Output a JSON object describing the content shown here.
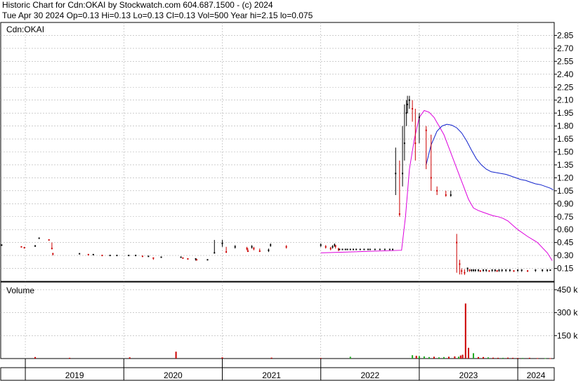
{
  "header": {
    "line1": "Historic Chart for Cdn:OKAI by Stockwatch.com 604.687.1500 - (c) 2024",
    "line2": "Tue Apr 30 2024  Op=0.13  Hi=0.13  Lo=0.13  Cl=0.13  Vol=500  Year hi=2.15  lo=0.075"
  },
  "colors": {
    "price_up": "#000000",
    "price_down": "#cc0000",
    "ma_short": "#dd00dd",
    "ma_long": "#1122cc",
    "grid": "#b0b0b0",
    "volume_up": "#cc0000",
    "volume_down": "#22aa22"
  },
  "chart_data": [
    {
      "type": "line",
      "title": "Cdn:OKAI",
      "grid": true,
      "ylim": [
        0,
        3.0
      ],
      "y_ticks": [
        "2.85",
        "2.70",
        "2.55",
        "2.40",
        "2.25",
        "2.10",
        "1.95",
        "1.80",
        "1.65",
        "1.50",
        "1.35",
        "1.20",
        "1.05",
        "0.90",
        "0.75",
        "0.60",
        "0.45",
        "0.30",
        "0.15"
      ],
      "x_ticks": [
        "2019",
        "2020",
        "2021",
        "2022",
        "2023",
        "2024"
      ],
      "x_range": [
        2018.75,
        2024.37
      ],
      "series": [
        {
          "kind": "price",
          "x": [
            2018.76,
            2018.96,
            2018.99,
            2019.1,
            2019.14,
            2019.24,
            2019.27,
            2019.28,
            2019.55,
            2019.64,
            2019.69,
            2019.78,
            2019.86,
            2019.93,
            2020.05,
            2020.12,
            2020.19,
            2020.25,
            2020.3,
            2020.38,
            2020.58,
            2020.6,
            2020.65,
            2020.73,
            2020.74,
            2020.85,
            2020.92,
            2021.0,
            2021.04,
            2021.13,
            2021.25,
            2021.26,
            2021.3,
            2021.32,
            2021.38,
            2021.47,
            2021.49,
            2021.65,
            2022.0,
            2022.05,
            2022.1,
            2022.12,
            2022.14,
            2022.15,
            2022.18,
            2022.19,
            2022.22,
            2022.25,
            2022.27,
            2022.3,
            2022.33,
            2022.36,
            2022.4,
            2022.44,
            2022.48,
            2022.5,
            2022.55,
            2022.6,
            2022.65,
            2022.7,
            2022.73,
            2022.76,
            2022.8,
            2022.83,
            2022.85,
            2022.87,
            2022.88,
            2022.9,
            2022.93,
            2022.96,
            2023.0,
            2023.07,
            2023.12,
            2023.18,
            2023.27,
            2023.32,
            2023.38,
            2023.41,
            2023.43,
            2023.46,
            2023.49,
            2023.51,
            2023.53,
            2023.55,
            2023.57,
            2023.6,
            2023.62,
            2023.65,
            2023.68,
            2023.71,
            2023.74,
            2023.77,
            2023.79,
            2023.81,
            2023.84,
            2023.88,
            2023.92,
            2023.96,
            2024.0,
            2024.04,
            2024.1,
            2024.18,
            2024.25,
            2024.3,
            2024.33
          ],
          "close": [
            0.42,
            0.4,
            0.39,
            0.41,
            0.5,
            0.48,
            0.38,
            0.32,
            0.32,
            0.31,
            0.31,
            0.3,
            0.3,
            0.3,
            0.3,
            0.3,
            0.29,
            0.29,
            0.27,
            0.28,
            0.28,
            0.27,
            0.26,
            0.26,
            0.25,
            0.25,
            0.33,
            0.44,
            0.34,
            0.4,
            0.38,
            0.35,
            0.4,
            0.38,
            0.35,
            0.36,
            0.42,
            0.4,
            0.42,
            0.4,
            0.38,
            0.4,
            0.42,
            0.41,
            0.37,
            0.37,
            0.37,
            0.37,
            0.37,
            0.37,
            0.37,
            0.37,
            0.37,
            0.37,
            0.37,
            0.37,
            0.37,
            0.37,
            0.37,
            0.37,
            0.37,
            1.25,
            0.78,
            1.25,
            1.6,
            1.95,
            2.05,
            2.1,
            2.0,
            1.6,
            1.9,
            1.75,
            1.2,
            1.05,
            1.0,
            1.0,
            0.45,
            0.2,
            0.12,
            0.1,
            0.15,
            0.13,
            0.13,
            0.13,
            0.13,
            0.13,
            0.12,
            0.13,
            0.13,
            0.12,
            0.13,
            0.13,
            0.12,
            0.13,
            0.13,
            0.13,
            0.13,
            0.12,
            0.13,
            0.13,
            0.12,
            0.13,
            0.13,
            0.13,
            0.13
          ],
          "high": [
            0.42,
            0.4,
            0.4,
            0.42,
            0.5,
            0.48,
            0.45,
            0.33,
            0.32,
            0.31,
            0.31,
            0.3,
            0.3,
            0.3,
            0.3,
            0.3,
            0.29,
            0.29,
            0.27,
            0.28,
            0.28,
            0.27,
            0.26,
            0.26,
            0.25,
            0.25,
            0.48,
            0.48,
            0.4,
            0.42,
            0.4,
            0.38,
            0.42,
            0.4,
            0.38,
            0.38,
            0.44,
            0.42,
            0.44,
            0.42,
            0.4,
            0.42,
            0.44,
            0.42,
            0.39,
            0.37,
            0.37,
            0.37,
            0.37,
            0.37,
            0.37,
            0.37,
            0.37,
            0.37,
            0.37,
            0.37,
            0.37,
            0.37,
            0.37,
            0.37,
            0.37,
            1.55,
            1.4,
            1.8,
            2.05,
            2.1,
            2.15,
            2.15,
            2.1,
            2.0,
            1.95,
            1.8,
            1.7,
            1.1,
            1.05,
            1.05,
            0.55,
            0.25,
            0.15,
            0.14,
            0.16,
            0.14,
            0.14,
            0.14,
            0.14,
            0.14,
            0.13,
            0.14,
            0.14,
            0.13,
            0.14,
            0.14,
            0.13,
            0.14,
            0.14,
            0.14,
            0.14,
            0.13,
            0.14,
            0.14,
            0.13,
            0.14,
            0.14,
            0.14,
            0.13
          ],
          "low": [
            0.42,
            0.4,
            0.38,
            0.4,
            0.5,
            0.48,
            0.38,
            0.3,
            0.32,
            0.31,
            0.31,
            0.3,
            0.3,
            0.3,
            0.3,
            0.3,
            0.29,
            0.29,
            0.25,
            0.28,
            0.28,
            0.27,
            0.26,
            0.24,
            0.25,
            0.25,
            0.33,
            0.4,
            0.33,
            0.38,
            0.36,
            0.34,
            0.38,
            0.36,
            0.34,
            0.34,
            0.4,
            0.38,
            0.4,
            0.38,
            0.36,
            0.38,
            0.4,
            0.38,
            0.35,
            0.37,
            0.37,
            0.37,
            0.37,
            0.37,
            0.37,
            0.37,
            0.37,
            0.37,
            0.37,
            0.37,
            0.37,
            0.37,
            0.37,
            0.37,
            0.37,
            1.0,
            0.75,
            1.1,
            1.4,
            1.8,
            1.95,
            2.0,
            1.85,
            1.4,
            1.6,
            1.3,
            1.05,
            1.0,
            0.98,
            0.98,
            0.1,
            0.08,
            0.08,
            0.075,
            0.11,
            0.11,
            0.11,
            0.11,
            0.11,
            0.11,
            0.11,
            0.11,
            0.11,
            0.11,
            0.11,
            0.11,
            0.11,
            0.11,
            0.11,
            0.11,
            0.11,
            0.11,
            0.11,
            0.11,
            0.11,
            0.11,
            0.11,
            0.11,
            0.13
          ]
        },
        {
          "kind": "ma_short",
          "x": [
            2022.0,
            2022.82,
            2022.86,
            2022.9,
            2022.95,
            2023.0,
            2023.05,
            2023.1,
            2023.15,
            2023.2,
            2023.25,
            2023.3,
            2023.35,
            2023.4,
            2023.45,
            2023.5,
            2023.55,
            2023.6,
            2023.65,
            2023.7,
            2023.75,
            2023.8,
            2023.85,
            2023.9,
            2023.95,
            2024.0,
            2024.1,
            2024.2,
            2024.3,
            2024.35
          ],
          "values": [
            0.33,
            0.36,
            0.75,
            1.3,
            1.65,
            1.9,
            1.98,
            1.96,
            1.9,
            1.8,
            1.7,
            1.55,
            1.4,
            1.25,
            1.1,
            0.95,
            0.85,
            0.82,
            0.8,
            0.78,
            0.76,
            0.75,
            0.73,
            0.7,
            0.65,
            0.6,
            0.52,
            0.45,
            0.33,
            0.24
          ]
        },
        {
          "kind": "ma_long",
          "x": [
            2023.07,
            2023.12,
            2023.18,
            2023.23,
            2023.28,
            2023.33,
            2023.38,
            2023.43,
            2023.48,
            2023.53,
            2023.58,
            2023.63,
            2023.68,
            2023.73,
            2023.78,
            2023.83,
            2023.88,
            2023.93,
            2023.98,
            2024.03,
            2024.08,
            2024.13,
            2024.18,
            2024.23,
            2024.28,
            2024.33,
            2024.36
          ],
          "values": [
            1.35,
            1.58,
            1.74,
            1.8,
            1.82,
            1.81,
            1.78,
            1.72,
            1.63,
            1.52,
            1.42,
            1.35,
            1.3,
            1.27,
            1.26,
            1.25,
            1.24,
            1.22,
            1.2,
            1.18,
            1.17,
            1.15,
            1.13,
            1.12,
            1.1,
            1.08,
            1.06
          ]
        }
      ]
    },
    {
      "type": "bar",
      "title": "Volume",
      "ylim": [
        0,
        500
      ],
      "y_unit": "k",
      "y_ticks": [
        "450 k",
        "300 k",
        "150 k"
      ],
      "x": [
        2019.1,
        2019.45,
        2020.06,
        2020.53,
        2021.0,
        2021.5,
        2022.0,
        2022.3,
        2022.93,
        2022.97,
        2023.0,
        2023.05,
        2023.1,
        2023.15,
        2023.2,
        2023.25,
        2023.3,
        2023.36,
        2023.4,
        2023.42,
        2023.44,
        2023.47,
        2023.5,
        2023.55,
        2023.6,
        2023.65,
        2023.7,
        2023.75,
        2023.8,
        2023.85,
        2023.9,
        2023.95,
        2024.0,
        2024.05,
        2024.12,
        2024.2,
        2024.28,
        2024.33
      ],
      "values": [
        10,
        5,
        8,
        45,
        8,
        6,
        4,
        12,
        22,
        18,
        16,
        14,
        10,
        12,
        8,
        10,
        12,
        14,
        12,
        20,
        25,
        360,
        70,
        35,
        10,
        10,
        8,
        6,
        5,
        5,
        6,
        5,
        4,
        4,
        5,
        3,
        3,
        2
      ],
      "up": [
        true,
        true,
        true,
        true,
        true,
        true,
        true,
        false,
        false,
        true,
        false,
        false,
        false,
        true,
        false,
        false,
        true,
        true,
        false,
        true,
        true,
        true,
        true,
        false,
        true,
        true,
        false,
        true,
        true,
        false,
        true,
        true,
        true,
        false,
        true,
        true,
        false,
        true
      ]
    }
  ]
}
